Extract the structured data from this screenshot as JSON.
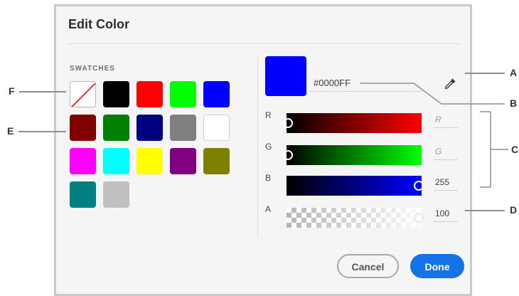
{
  "dialog": {
    "title": "Edit Color",
    "swatches_heading": "SWATCHES",
    "swatches": [
      {
        "name": "none",
        "color": "none"
      },
      {
        "name": "black",
        "color": "#000000"
      },
      {
        "name": "red",
        "color": "#FF0000"
      },
      {
        "name": "lime",
        "color": "#00FF00"
      },
      {
        "name": "blue",
        "color": "#0000FF"
      },
      {
        "name": "maroon",
        "color": "#800000"
      },
      {
        "name": "green",
        "color": "#008000"
      },
      {
        "name": "navy",
        "color": "#000080"
      },
      {
        "name": "gray",
        "color": "#808080"
      },
      {
        "name": "white",
        "color": "#FFFFFF"
      },
      {
        "name": "magenta",
        "color": "#FF00FF"
      },
      {
        "name": "cyan",
        "color": "#00FFFF"
      },
      {
        "name": "yellow",
        "color": "#FFFF00"
      },
      {
        "name": "purple",
        "color": "#800080"
      },
      {
        "name": "olive",
        "color": "#808000"
      },
      {
        "name": "teal",
        "color": "#008080"
      },
      {
        "name": "silver",
        "color": "#C0C0C0"
      }
    ],
    "preview_color": "#0000FF",
    "hex_value": "#0000FF",
    "eyedropper_icon": "eyedropper-icon",
    "channels": {
      "r": {
        "label": "R",
        "value": "",
        "placeholder": "R",
        "position": 0
      },
      "g": {
        "label": "G",
        "value": "",
        "placeholder": "G",
        "position": 0
      },
      "b": {
        "label": "B",
        "value": "255",
        "placeholder": "B",
        "position": 1
      },
      "a": {
        "label": "A",
        "value": "100",
        "placeholder": "A",
        "position": 1
      }
    },
    "cancel_label": "Cancel",
    "done_label": "Done",
    "accent_color": "#1473E6"
  },
  "callouts": {
    "a": "A",
    "b": "B",
    "c": "C",
    "d": "D",
    "e": "E",
    "f": "F"
  }
}
